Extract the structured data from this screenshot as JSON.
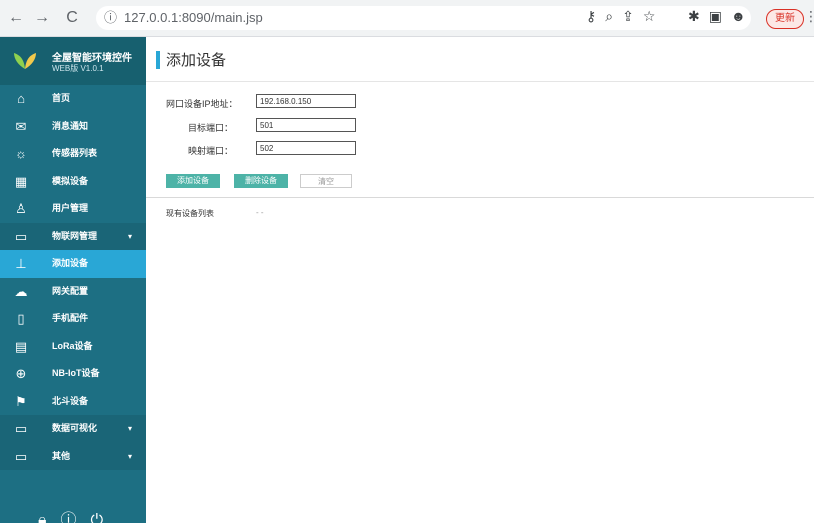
{
  "browser": {
    "back": "←",
    "forward": "→",
    "reload": "C",
    "url": "127.0.0.1:8090/main.jsp",
    "update_label": "更新",
    "kebab": "⋮"
  },
  "sidebar": {
    "brand_title": "全屋智能环境控件",
    "brand_subtitle": "WEB版 V1.0.1",
    "items": [
      {
        "icon": "home-icon",
        "label": "首页"
      },
      {
        "icon": "mail-icon",
        "label": "消息通知"
      },
      {
        "icon": "sun-icon",
        "label": "传感器列表"
      },
      {
        "icon": "grid-icon",
        "label": "模拟设备"
      },
      {
        "icon": "user-icon",
        "label": "用户管理"
      },
      {
        "icon": "device-icon",
        "label": "物联网管理",
        "caret": "▾"
      },
      {
        "icon": "network-icon",
        "label": "添加设备"
      },
      {
        "icon": "cloud-icon",
        "label": "网关配置"
      },
      {
        "icon": "phone-icon",
        "label": "手机配件"
      },
      {
        "icon": "lora-icon",
        "label": "LoRa设备"
      },
      {
        "icon": "globe-icon",
        "label": "NB-IoT设备"
      },
      {
        "icon": "flag-icon",
        "label": "北斗设备"
      },
      {
        "icon": "device-icon",
        "label": "数据可视化",
        "caret": "▾"
      },
      {
        "icon": "device-icon",
        "label": "其他",
        "caret": "▾"
      }
    ],
    "active_index": 6,
    "group_indexes": [
      5,
      12,
      13
    ]
  },
  "main": {
    "title": "添加设备",
    "form": {
      "ip_label": "网口设备IP地址：",
      "ip_value": "192.168.0.150",
      "port1_label": "目标端口：",
      "port1_value": "501",
      "port2_label": "映射端口：",
      "port2_value": "502"
    },
    "buttons": {
      "add": "添加设备",
      "delete": "删除设备",
      "clear": "清空"
    },
    "list_label": "现有设备列表",
    "list_value": "- -"
  },
  "colors": {
    "sidebar": "#1d6f83",
    "active": "#29a7d6",
    "button": "#4db3a7"
  }
}
